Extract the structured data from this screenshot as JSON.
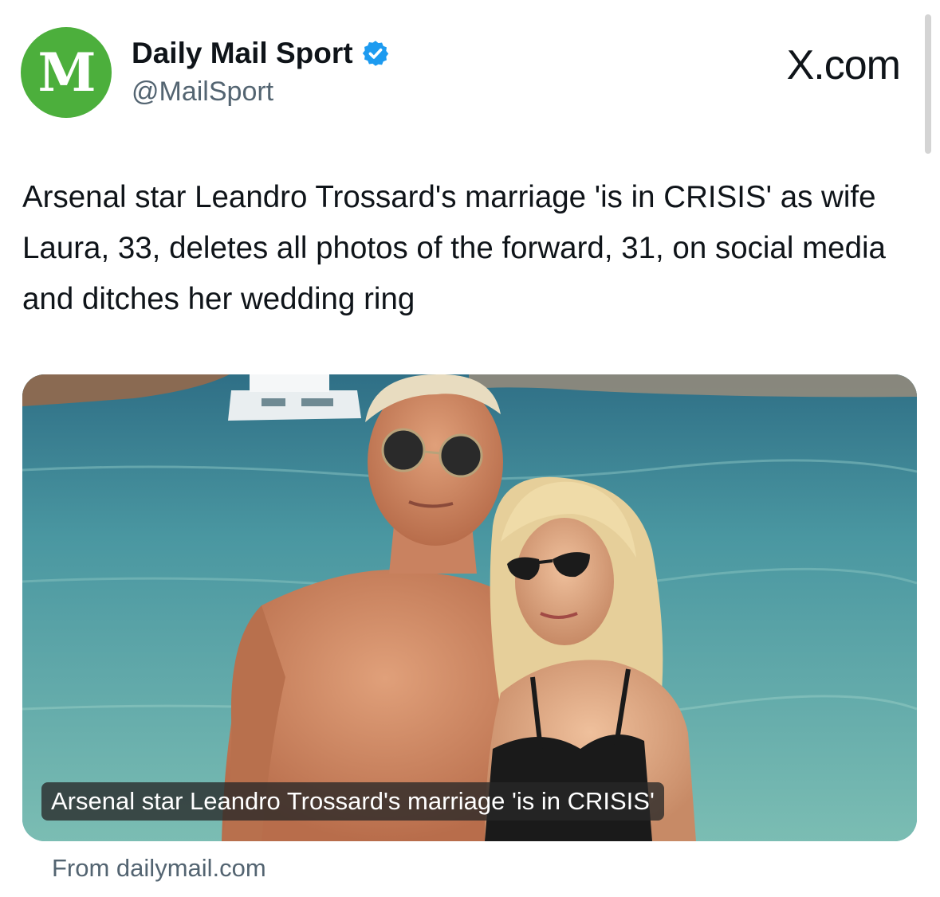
{
  "tweet": {
    "author": {
      "display_name": "Daily Mail Sport",
      "handle": "@MailSport",
      "avatar_glyph": "M",
      "avatar_color": "#4caf3c",
      "verified_color": "#1d9bf0"
    },
    "brand_label": "X.com",
    "headline": "Arsenal star Leandro Trossard's marriage 'is in CRISIS' as wife Laura, 33, deletes all photos of the forward, 31, on social media and ditches her wedding ring",
    "card": {
      "caption": "Arsenal star Leandro Trossard's marriage 'is in CRISIS'",
      "source": "From dailymail.com"
    }
  },
  "colors": {
    "text_primary": "#0f1419",
    "text_secondary": "#536471",
    "sea": "#4f9fa3"
  }
}
